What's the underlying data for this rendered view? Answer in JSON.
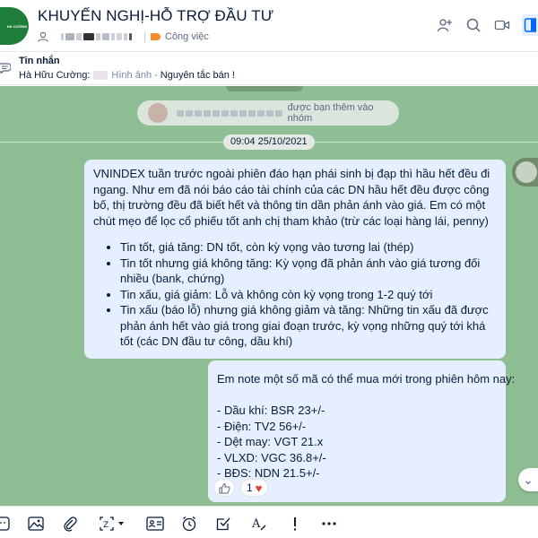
{
  "header": {
    "title": "KHUYẾN NGHỊ-HỖ TRỢ ĐẦU TƯ",
    "category_label": "Công việc",
    "group_avatar_text": "HÀ CƯỜNG"
  },
  "pinned": {
    "title": "Tin nhắn",
    "sender": "Hà Hữu Cường:",
    "attachment_label": "Hình ảnh",
    "text": "· Nguyên tắc bán !"
  },
  "chat": {
    "date_top": "— — — — — —",
    "notification_text": "được bạn thêm vào nhóm",
    "timestamp": "09:04 25/10/2021",
    "message1": {
      "intro": "VNINDEX tuần trước ngoài phiên đáo hạn phái sinh bị đạp thì hầu hết đều đi ngang. Như em đã nói báo cáo tài chính của các DN hầu hết đều được công bố, thị trường đều đã biết hết và thông tin dần phản ánh vào giá. Em có một chút mẹo để lọc cổ phiếu tốt anh chị tham khảo (trừ các loại hàng lái, penny)",
      "bullets": [
        "Tin tốt, giá tăng: DN tốt, còn kỳ vọng vào tương lai (thép)",
        "Tin tốt nhưng giá không tăng: Kỳ vọng đã phản ánh vào giá tương đối nhiều (bank, chứng)",
        "Tin xấu, giá giảm: Lỗ và không còn kỳ vọng trong 1-2 quý tới",
        "Tin xấu (báo lỗ) nhưng giá không giảm và tăng: Những tin xấu đã được phản ánh hết vào giá trong giai đoạn trước, kỳ vọng những quý tới khá tốt (các DN đầu tư công, dầu khí)"
      ]
    },
    "message2": {
      "intro": "Em note một số mã có thể mua mới trong phiên hôm nay:",
      "items": [
        "- Dầu khí: BSR 23+/-",
        "- Điện: TV2 56+/-",
        "- Dệt may: VGT 21.x",
        "- VLXD: VGC 36.8+/-",
        "- BĐS: NDN 21.5+/-"
      ]
    },
    "reaction_count": "1"
  },
  "colors": {
    "chat_background": "#8fbd94",
    "bubble": "#e5efff",
    "tag": "#f28b30",
    "accent": "#0068ff"
  }
}
